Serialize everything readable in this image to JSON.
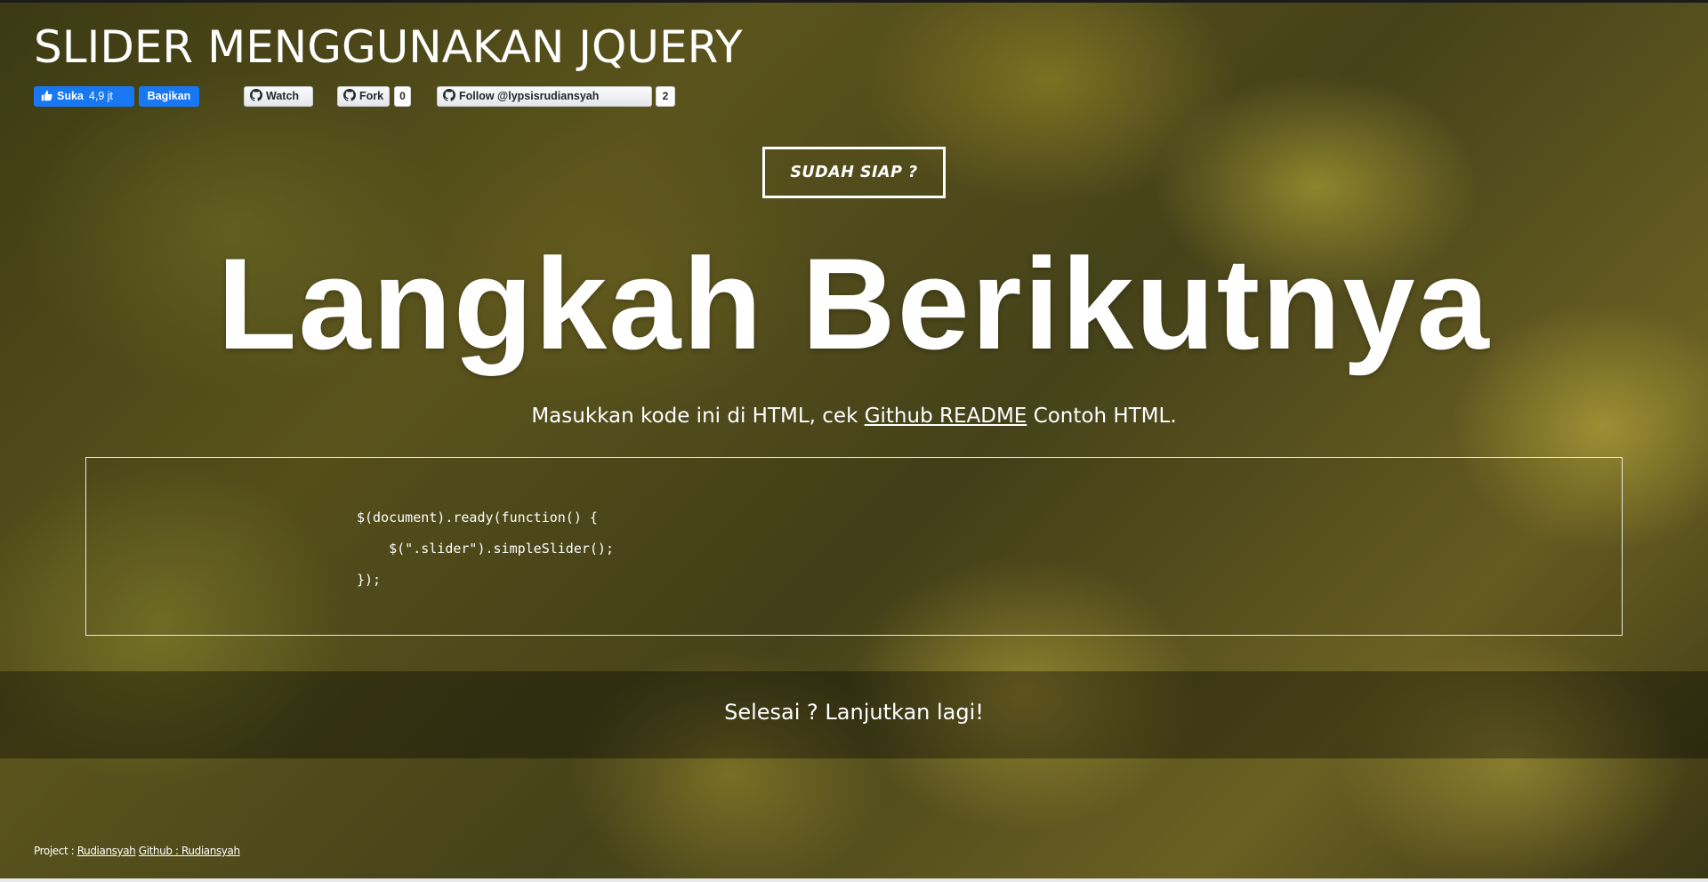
{
  "header": {
    "title": "SLIDER MENGGUNAKAN JQUERY"
  },
  "social": {
    "fb_like_label": "Suka",
    "fb_like_count": "4,9 jt",
    "fb_share_label": "Bagikan",
    "gh_watch_label": "Watch",
    "gh_fork_label": "Fork",
    "gh_fork_count": "0",
    "gh_follow_label": "Follow @lypsisrudiansyah",
    "gh_follow_count": "2",
    "fb_color": "#1877f2"
  },
  "hero": {
    "cta_label": "SUDAH SIAP ?",
    "heading": "Langkah Berikutnya",
    "subtitle_before": "Masukkan kode ini di HTML, cek ",
    "subtitle_link": "Github README",
    "subtitle_after": " Contoh HTML."
  },
  "code": {
    "line1": "$(document).ready(function() {",
    "line2": "    $(\".slider\").simpleSlider();",
    "line3": "});"
  },
  "band": {
    "text": "Selesai ? Lanjutkan lagi!"
  },
  "footer": {
    "project_label": "Project : ",
    "project_link": "Rudiansyah",
    "github_link": "Github : Rudiansyah"
  }
}
